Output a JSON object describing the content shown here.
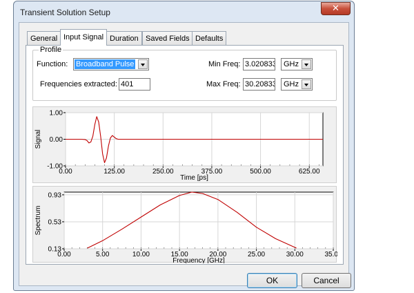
{
  "window": {
    "title": "Transient Solution Setup",
    "close_glyph": "✕"
  },
  "tabs": [
    {
      "label": "General",
      "active": false
    },
    {
      "label": "Input Signal",
      "active": true
    },
    {
      "label": "Duration",
      "active": false
    },
    {
      "label": "Saved Fields",
      "active": false
    },
    {
      "label": "Defaults",
      "active": false
    }
  ],
  "profile": {
    "group_label": "Profile",
    "function_label": "Function:",
    "function_value": "Broadband Pulse",
    "frequencies_label": "Frequencies extracted:",
    "frequencies_value": "401",
    "min_freq_label": "Min Freq:",
    "min_freq_value": "3.020833",
    "min_freq_unit": "GHz",
    "max_freq_label": "Max Freq:",
    "max_freq_value": "30.20833",
    "max_freq_unit": "GHz"
  },
  "buttons": {
    "ok": "OK",
    "cancel": "Cancel"
  },
  "chart_data": [
    {
      "type": "line",
      "xlabel": "Time [ps]",
      "ylabel": "Signal",
      "xlim": [
        0,
        660
      ],
      "ylim": [
        -1.0,
        1.0
      ],
      "xticks": [
        0,
        125,
        250,
        375,
        500,
        625
      ],
      "xtick_labels": [
        "0.00",
        "125.00",
        "250.00",
        "375.00",
        "500.00",
        "625.00"
      ],
      "yticks": [
        -1.0,
        0.0,
        1.0
      ],
      "ytick_labels": [
        "-1.00",
        "0.00",
        "1.00"
      ],
      "grid": true,
      "line_color": "#c00000",
      "series": [
        {
          "x": [
            0,
            40,
            50,
            55,
            60,
            65,
            70,
            75,
            80,
            85,
            90,
            95,
            100,
            105,
            110,
            115,
            120,
            125,
            130,
            135,
            140,
            150,
            175,
            250,
            400,
            550,
            660
          ],
          "y": [
            0,
            0,
            -0.01,
            -0.05,
            -0.14,
            -0.1,
            0.12,
            0.55,
            0.85,
            0.65,
            0.1,
            -0.55,
            -0.88,
            -0.7,
            -0.25,
            0.05,
            0.14,
            0.08,
            0.02,
            0,
            0,
            0,
            0,
            0,
            0,
            0,
            0
          ]
        }
      ]
    },
    {
      "type": "line",
      "xlabel": "Frequency [GHz]",
      "ylabel": "Spectrum",
      "xlim": [
        0,
        35
      ],
      "ylim": [
        0.13,
        0.97
      ],
      "xticks": [
        0,
        5,
        10,
        15,
        20,
        25,
        30,
        35
      ],
      "xtick_labels": [
        "0.00",
        "5.00",
        "10.00",
        "15.00",
        "20.00",
        "25.00",
        "30.00",
        "35.00"
      ],
      "yticks": [
        0.13,
        0.53,
        0.93
      ],
      "ytick_labels": [
        "0.13",
        "0.53",
        "0.93"
      ],
      "grid": true,
      "line_color": "#c00000",
      "series": [
        {
          "x": [
            3.02,
            5,
            7.5,
            10,
            12.5,
            15,
            16.6,
            18,
            20,
            22.5,
            25,
            27.5,
            30.21
          ],
          "y": [
            0.14,
            0.25,
            0.42,
            0.6,
            0.78,
            0.92,
            0.97,
            0.95,
            0.86,
            0.67,
            0.45,
            0.28,
            0.14
          ]
        }
      ]
    }
  ]
}
